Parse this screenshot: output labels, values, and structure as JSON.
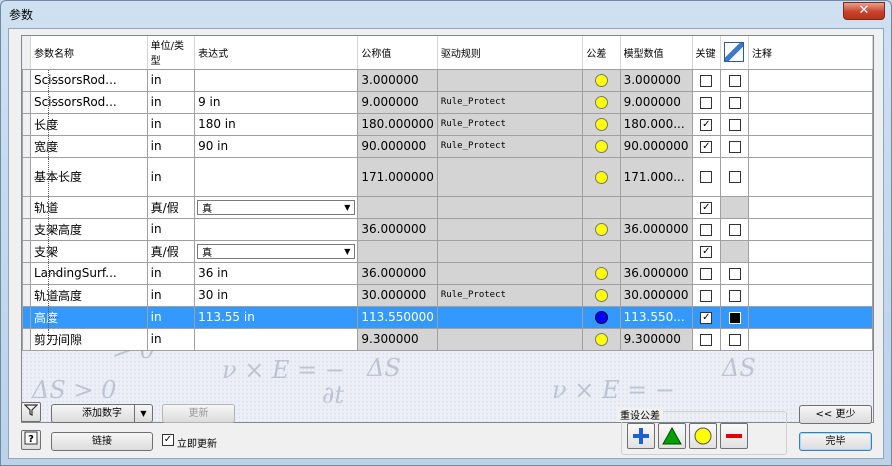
{
  "window": {
    "title": "参数",
    "close_glyph": "✕"
  },
  "columns": [
    "参数名称",
    "单位/类型",
    "表达式",
    "公称值",
    "驱动规则",
    "公差",
    "模型数值",
    "关键",
    "",
    "注释"
  ],
  "rows": [
    {
      "name": "ScissorsRod...",
      "unit": "in",
      "expr": "",
      "nominal": "3.000000",
      "rule": "",
      "tol": "yellow",
      "model": "3.000000",
      "key": false,
      "export": false
    },
    {
      "name": "ScissorsRod...",
      "unit": "in",
      "expr": "9 in",
      "nominal": "9.000000",
      "rule": "Rule_Protect",
      "tol": "yellow",
      "model": "9.000000",
      "key": false,
      "export": false
    },
    {
      "name": "长度",
      "unit": "in",
      "expr": "180 in",
      "nominal": "180.000000",
      "rule": "Rule_Protect",
      "tol": "yellow",
      "model": "180.000...",
      "key": true,
      "export": false
    },
    {
      "name": "宽度",
      "unit": "in",
      "expr": "90 in",
      "nominal": "90.000000",
      "rule": "Rule_Protect",
      "tol": "yellow",
      "model": "90.000000",
      "key": true,
      "export": false
    },
    {
      "name": "基本长度",
      "unit": "in",
      "expr": "",
      "nominal": "171.000000",
      "rule": "",
      "tol": "yellow",
      "model": "171.000...",
      "key": false,
      "export": false
    },
    {
      "name": "轨道",
      "unit": "真/假",
      "expr_combo": "真",
      "nominal": "",
      "rule": "",
      "tol": "",
      "model": "",
      "key": true,
      "export": null
    },
    {
      "name": "支架高度",
      "unit": "in",
      "expr": "",
      "nominal": "36.000000",
      "rule": "",
      "tol": "yellow",
      "model": "36.000000",
      "key": false,
      "export": false
    },
    {
      "name": "支架",
      "unit": "真/假",
      "expr_combo": "真",
      "nominal": "",
      "rule": "",
      "tol": "",
      "model": "",
      "key": true,
      "export": null
    },
    {
      "name": "LandingSurf...",
      "unit": "in",
      "expr": "36 in",
      "nominal": "36.000000",
      "rule": "",
      "tol": "yellow",
      "model": "36.000000",
      "key": false,
      "export": false
    },
    {
      "name": "轨道高度",
      "unit": "in",
      "expr": "30 in",
      "nominal": "30.000000",
      "rule": "Rule_Protect",
      "tol": "yellow",
      "model": "30.000000",
      "key": false,
      "export": false
    },
    {
      "name": "高度",
      "unit": "in",
      "expr": "113.55 in",
      "nominal": "113.550000",
      "rule": "",
      "tol": "blue",
      "model": "113.550...",
      "key": true,
      "export": false,
      "selected": true
    },
    {
      "name": "剪刀间隙",
      "unit": "in",
      "expr": "",
      "nominal": "9.300000",
      "rule": "",
      "tol": "yellow",
      "model": "9.300000",
      "key": false,
      "export": false
    }
  ],
  "watermark": [
    "> 0",
    "ΔS",
    "ν × E = −",
    "∂t",
    "ΔS > 0"
  ],
  "bottom": {
    "add_number": "添加数字",
    "update": "更新",
    "link": "链接",
    "immediate_update": "立即更新",
    "reset_tolerance": "重设公差",
    "less": "<< 更少",
    "done": "完毕"
  },
  "icons": {
    "filter": "filter-icon",
    "help": "help-icon",
    "export_header": "export-parameter-icon"
  },
  "colors": {
    "selection": "#3399ff",
    "tol_yellow": "#ffff00",
    "tol_blue": "#0000ff",
    "green": "#00a000",
    "red": "#e00000",
    "plus_blue": "#1f5fd6"
  }
}
